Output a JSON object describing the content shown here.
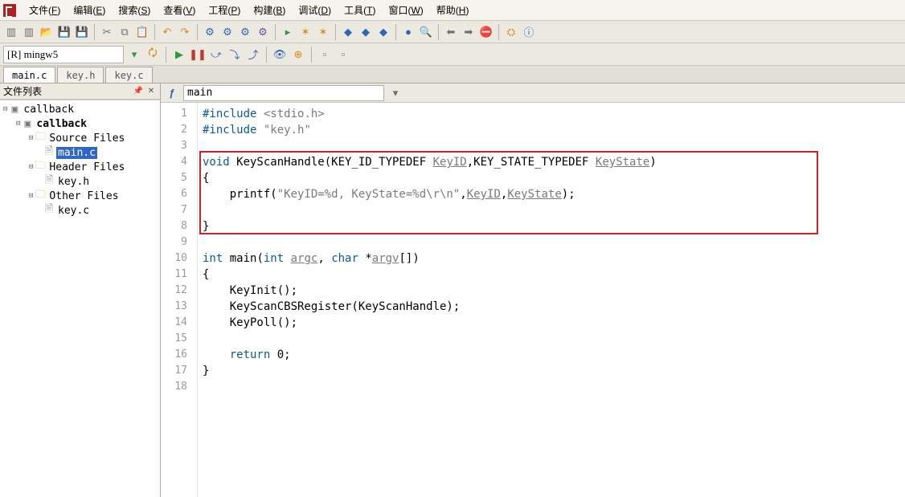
{
  "menu": {
    "items": [
      {
        "label": "文件(F)",
        "hot": "F"
      },
      {
        "label": "编辑(E)",
        "hot": "E"
      },
      {
        "label": "搜索(S)",
        "hot": "S"
      },
      {
        "label": "查看(V)",
        "hot": "V"
      },
      {
        "label": "工程(P)",
        "hot": "P"
      },
      {
        "label": "构建(B)",
        "hot": "B"
      },
      {
        "label": "调试(D)",
        "hot": "D"
      },
      {
        "label": "工具(T)",
        "hot": "T"
      },
      {
        "label": "窗口(W)",
        "hot": "W"
      },
      {
        "label": "帮助(H)",
        "hot": "H"
      }
    ]
  },
  "config": {
    "current": "[R] mingw5"
  },
  "doc_tabs": [
    {
      "name": "main.c",
      "active": true
    },
    {
      "name": "key.h",
      "active": false
    },
    {
      "name": "key.c",
      "active": false
    }
  ],
  "panel": {
    "title": "文件列表"
  },
  "tree": {
    "root": "callback",
    "project": "callback",
    "groups": [
      {
        "name": "Source Files",
        "files": [
          {
            "name": "main.c",
            "selected": true
          }
        ]
      },
      {
        "name": "Header Files",
        "files": [
          {
            "name": "key.h",
            "selected": false
          }
        ]
      },
      {
        "name": "Other Files",
        "files": [
          {
            "name": "key.c",
            "selected": false
          }
        ]
      }
    ]
  },
  "editor": {
    "function_selector": "main",
    "lines": [
      {
        "n": 1,
        "html": "<span class='kw'>#include</span> <span class='str'>&lt;stdio.h&gt;</span>"
      },
      {
        "n": 2,
        "html": "<span class='kw'>#include</span> <span class='str'>\"key.h\"</span>"
      },
      {
        "n": 3,
        "html": ""
      },
      {
        "n": 4,
        "html": "<span class='kw'>void</span> KeyScanHandle(KEY_ID_TYPEDEF <span class='dim'>KeyID</span>,KEY_STATE_TYPEDEF <span class='dim'>KeyState</span>)"
      },
      {
        "n": 5,
        "html": "{"
      },
      {
        "n": 6,
        "html": "    printf(<span class='strlit'>\"KeyID=%d, KeyState=%d\\r\\n\"</span>,<span class='dim'>KeyID</span>,<span class='dim'>KeyState</span>);"
      },
      {
        "n": 7,
        "html": ""
      },
      {
        "n": 8,
        "html": "}"
      },
      {
        "n": 9,
        "html": ""
      },
      {
        "n": 10,
        "html": "<span class='kw'>int</span> main(<span class='kw'>int</span> <span class='dim'>argc</span>, <span class='kw'>char</span> *<span class='dim'>argv</span>[])"
      },
      {
        "n": 11,
        "html": "{"
      },
      {
        "n": 12,
        "html": "    KeyInit();"
      },
      {
        "n": 13,
        "html": "    KeyScanCBSRegister(KeyScanHandle);"
      },
      {
        "n": 14,
        "html": "    KeyPoll();"
      },
      {
        "n": 15,
        "html": ""
      },
      {
        "n": 16,
        "html": "    <span class='kw'>return</span> 0;"
      },
      {
        "n": 17,
        "html": "}"
      },
      {
        "n": 18,
        "html": ""
      }
    ]
  }
}
